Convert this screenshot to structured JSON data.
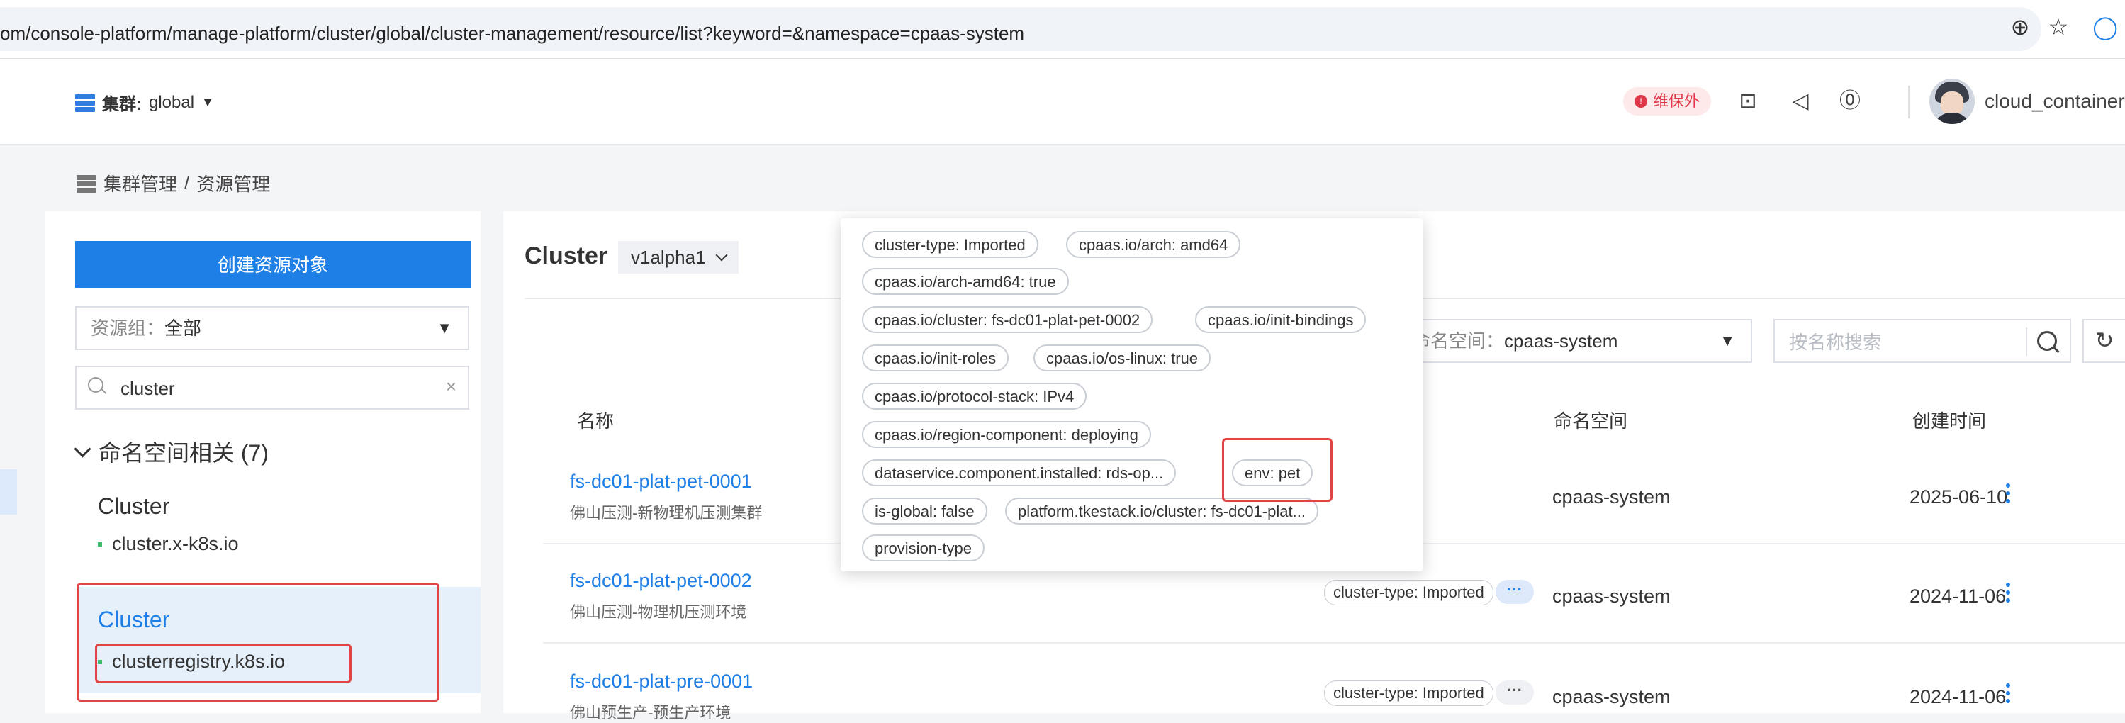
{
  "browser": {
    "url": "om/console-platform/manage-platform/cluster/global/cluster-management/resource/list?keyword=&namespace=cpaas-system"
  },
  "header": {
    "cluster_label": "集群:",
    "cluster_value": "global",
    "maintenance_badge": "维保外",
    "username": "cloud_container"
  },
  "breadcrumb": {
    "root": "集群管理",
    "sep": "/",
    "current": "资源管理"
  },
  "sidebar": {
    "create_button": "创建资源对象",
    "resource_group_label": "资源组：",
    "resource_group_value": "全部",
    "search_value": "cluster",
    "group_title": "命名空间相关 (7)",
    "items": [
      {
        "kind": "Cluster",
        "group": "cluster.x-k8s.io"
      },
      {
        "kind": "Cluster",
        "group": "clusterregistry.k8s.io"
      }
    ]
  },
  "main": {
    "kind_title": "Cluster",
    "version": "v1alpha1",
    "namespace_label": "命名空间：",
    "namespace_value": "cpaas-system",
    "name_search_placeholder": "按名称搜索",
    "columns": {
      "name": "名称",
      "namespace": "命名空间",
      "created": "创建时间"
    },
    "rows": [
      {
        "name": "fs-dc01-plat-pet-0001",
        "desc": "佛山压测-新物理机压测集群",
        "namespace": "cpaas-system",
        "created": "2025-06-10"
      },
      {
        "name": "fs-dc01-plat-pet-0002",
        "desc": "佛山压测-物理机压测环境",
        "tag": "cluster-type: Imported",
        "namespace": "cpaas-system",
        "created": "2024-11-06"
      },
      {
        "name": "fs-dc01-plat-pre-0001",
        "desc": "佛山预生产-预生产环境",
        "tag": "cluster-type: Imported",
        "namespace": "cpaas-system",
        "created": "2024-11-06"
      }
    ]
  },
  "popover": {
    "labels": [
      "cluster-type: Imported",
      "cpaas.io/arch: amd64",
      "cpaas.io/arch-amd64: true",
      "cpaas.io/cluster: fs-dc01-plat-pet-0002",
      "cpaas.io/init-bindings",
      "cpaas.io/init-roles",
      "cpaas.io/os-linux: true",
      "cpaas.io/protocol-stack: IPv4",
      "cpaas.io/region-component: deploying",
      "dataservice.component.installed: rds-op...",
      "env: pet",
      "is-global: false",
      "platform.tkestack.io/cluster: fs-dc01-plat...",
      "provision-type"
    ]
  },
  "colors": {
    "accent": "#1e7fe6",
    "highlight_border": "#e04444",
    "selected_bg": "#e6f0fb",
    "badge_red": "#e0364a"
  }
}
